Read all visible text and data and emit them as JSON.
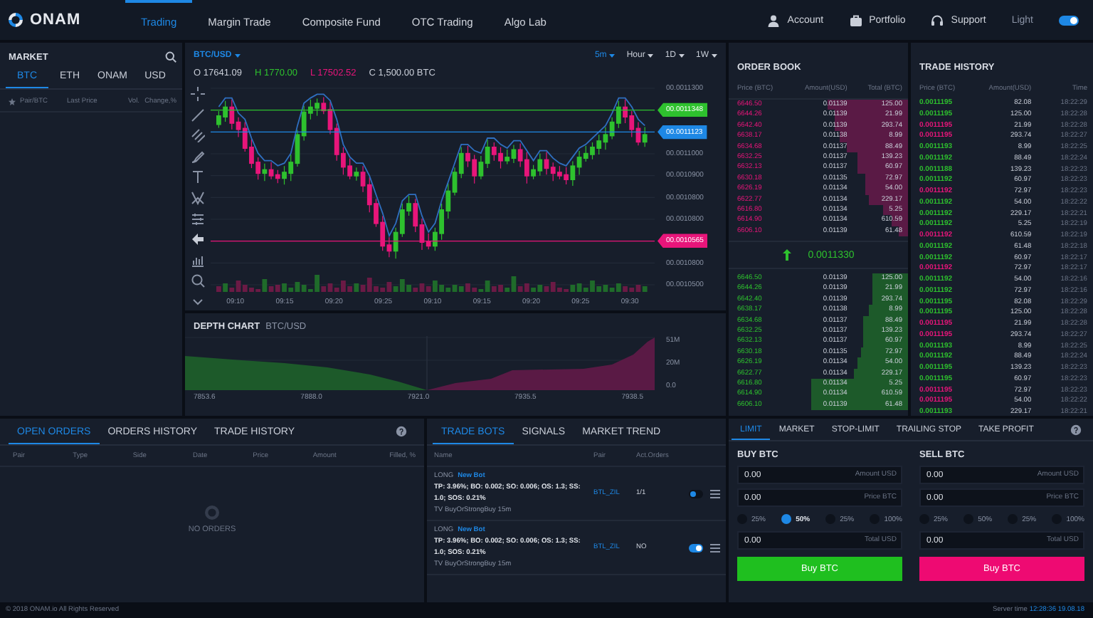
{
  "nav": {
    "logo": "ONAM",
    "items": [
      {
        "label": "Trading",
        "selected": true
      },
      {
        "label": "Margin Trade",
        "selected": false
      },
      {
        "label": "Composite Fund",
        "selected": false
      },
      {
        "label": "OTC Trading",
        "selected": false
      },
      {
        "label": "Algo Lab",
        "selected": false
      }
    ],
    "right": [
      {
        "kind": "account",
        "label": "Account"
      },
      {
        "kind": "portfolio",
        "label": "Portfolio"
      },
      {
        "kind": "support",
        "label": "Support"
      }
    ],
    "theme": {
      "label": "Light",
      "on": true
    }
  },
  "market": {
    "title": "MARKET",
    "tabs": [
      {
        "label": "BTC",
        "selected": true
      },
      {
        "label": "ETH",
        "selected": false
      },
      {
        "label": "ONAM",
        "selected": false
      },
      {
        "label": "USD",
        "selected": false
      }
    ],
    "columns": [
      "Pair/BTC",
      "Last Price",
      "Vol.",
      "Change,%"
    ]
  },
  "chart": {
    "pair": "BTC/USD",
    "intervals": [
      {
        "label": "5m",
        "selected": true
      },
      {
        "label": "Hour",
        "selected": false
      },
      {
        "label": "1D",
        "selected": false
      },
      {
        "label": "1W",
        "selected": false
      }
    ],
    "ohlc": [
      {
        "kind": "open",
        "text": "O 17641.09"
      },
      {
        "kind": "high",
        "text": "H 1770.00"
      },
      {
        "kind": "low",
        "text": "L 17502.52"
      },
      {
        "kind": "close",
        "text": "C 1,500.00 BTC"
      }
    ],
    "y_axis": [
      {
        "kind": "tick",
        "label": "00.0011300"
      },
      {
        "kind": "tag",
        "label": "00.0011348",
        "color": "#2ec12e"
      },
      {
        "kind": "tag",
        "label": "00.0011123",
        "color": "#1e88e5"
      },
      {
        "kind": "tick",
        "label": "00.0011000"
      },
      {
        "kind": "tick",
        "label": "00.0010900"
      },
      {
        "kind": "tick",
        "label": "00.0010800"
      },
      {
        "kind": "tick",
        "label": "00.0010800"
      },
      {
        "kind": "tag",
        "label": "00.0010565",
        "color": "#e8157a"
      },
      {
        "kind": "tick",
        "label": "00.0010800"
      },
      {
        "kind": "tick",
        "label": "00.0010500"
      }
    ],
    "x_axis": [
      "09:10",
      "09:15",
      "09:20",
      "09:25",
      "09:10",
      "09:15",
      "09:20",
      "09:25",
      "09:30"
    ]
  },
  "depth_chart": {
    "title": "DEPTH CHART",
    "pair": "BTC/USD",
    "y_axis": [
      "51M",
      "20M",
      "0.0"
    ],
    "x_axis": [
      "7853.6",
      "7888.0",
      "7921.0",
      "7935.5",
      "7938.5"
    ]
  },
  "order_book": {
    "title": "ORDER BOOK",
    "columns": [
      "Price (BTC)",
      "Amount(USD)",
      "Total (BTC)"
    ],
    "asks": [
      {
        "price": "6646.50",
        "amount": "0.01139",
        "total": "125.00"
      },
      {
        "price": "6644.26",
        "amount": "0.01139",
        "total": "21.99"
      },
      {
        "price": "6642.40",
        "amount": "0.01139",
        "total": "293.74"
      },
      {
        "price": "6638.17",
        "amount": "0.01138",
        "total": "8.99"
      },
      {
        "price": "6634.68",
        "amount": "0.01137",
        "total": "88.49"
      },
      {
        "price": "6632.25",
        "amount": "0.01137",
        "total": "139.23"
      },
      {
        "price": "6632.13",
        "amount": "0.01137",
        "total": "60.97"
      },
      {
        "price": "6630.18",
        "amount": "0.01135",
        "total": "72.97"
      },
      {
        "price": "6626.19",
        "amount": "0.01134",
        "total": "54.00"
      },
      {
        "price": "6622.77",
        "amount": "0.01134",
        "total": "229.17"
      },
      {
        "price": "6616.80",
        "amount": "0.01134",
        "total": "5.25"
      },
      {
        "price": "6614.90",
        "amount": "0.01134",
        "total": "610.59"
      },
      {
        "price": "6606.10",
        "amount": "0.01139",
        "total": "61.48"
      }
    ],
    "last_price": "0.0011330",
    "bids": [
      {
        "price": "6646.50",
        "amount": "0.01139",
        "total": "125.00"
      },
      {
        "price": "6644.26",
        "amount": "0.01139",
        "total": "21.99"
      },
      {
        "price": "6642.40",
        "amount": "0.01139",
        "total": "293.74"
      },
      {
        "price": "6638.17",
        "amount": "0.01138",
        "total": "8.99"
      },
      {
        "price": "6634.68",
        "amount": "0.01137",
        "total": "88.49"
      },
      {
        "price": "6632.25",
        "amount": "0.01137",
        "total": "139.23"
      },
      {
        "price": "6632.13",
        "amount": "0.01137",
        "total": "60.97"
      },
      {
        "price": "6630.18",
        "amount": "0.01135",
        "total": "72.97"
      },
      {
        "price": "6626.19",
        "amount": "0.01134",
        "total": "54.00"
      },
      {
        "price": "6622.77",
        "amount": "0.01134",
        "total": "229.17"
      },
      {
        "price": "6616.80",
        "amount": "0.01134",
        "total": "5.25"
      },
      {
        "price": "6614.90",
        "amount": "0.01134",
        "total": "610.59"
      },
      {
        "price": "6606.10",
        "amount": "0.01139",
        "total": "61.48"
      }
    ]
  },
  "trade_history": {
    "title": "TRADE HISTORY",
    "columns": [
      "Price (BTC)",
      "Amount(USD)",
      "Time"
    ],
    "rows": [
      {
        "price": "0.0011195",
        "amount": "82.08",
        "time": "18:22:29",
        "color": "#2ec12e"
      },
      {
        "price": "0.0011195",
        "amount": "125.00",
        "time": "18:22:28",
        "color": "#2ec12e"
      },
      {
        "price": "0.0011195",
        "amount": "21.99",
        "time": "18:22:28",
        "color": "#e8157a"
      },
      {
        "price": "0.0011195",
        "amount": "293.74",
        "time": "18:22:27",
        "color": "#e8157a"
      },
      {
        "price": "0.0011193",
        "amount": "8.99",
        "time": "18:22:25",
        "color": "#2ec12e"
      },
      {
        "price": "0.0011192",
        "amount": "88.49",
        "time": "18:22:24",
        "color": "#2ec12e"
      },
      {
        "price": "0.0011188",
        "amount": "139.23",
        "time": "18:22:23",
        "color": "#2ec12e"
      },
      {
        "price": "0.0011192",
        "amount": "60.97",
        "time": "18:22:23",
        "color": "#2ec12e"
      },
      {
        "price": "0.0011192",
        "amount": "72.97",
        "time": "18:22:23",
        "color": "#e8157a"
      },
      {
        "price": "0.0011192",
        "amount": "54.00",
        "time": "18:22:22",
        "color": "#2ec12e"
      },
      {
        "price": "0.0011192",
        "amount": "229.17",
        "time": "18:22:21",
        "color": "#2ec12e"
      },
      {
        "price": "0.0011192",
        "amount": "5.25",
        "time": "18:22:19",
        "color": "#2ec12e"
      },
      {
        "price": "0.0011192",
        "amount": "610.59",
        "time": "18:22:19",
        "color": "#e8157a"
      },
      {
        "price": "0.0011192",
        "amount": "61.48",
        "time": "18:22:18",
        "color": "#2ec12e"
      },
      {
        "price": "0.0011192",
        "amount": "60.97",
        "time": "18:22:17",
        "color": "#2ec12e"
      },
      {
        "price": "0.0011192",
        "amount": "72.97",
        "time": "18:22:17",
        "color": "#e8157a"
      },
      {
        "price": "0.0011192",
        "amount": "54.00",
        "time": "18:22:16",
        "color": "#2ec12e"
      },
      {
        "price": "0.0011192",
        "amount": "72.97",
        "time": "18:22:16",
        "color": "#2ec12e"
      },
      {
        "price": "0.0011195",
        "amount": "82.08",
        "time": "18:22:29",
        "color": "#2ec12e"
      },
      {
        "price": "0.0011195",
        "amount": "125.00",
        "time": "18:22:28",
        "color": "#2ec12e"
      },
      {
        "price": "0.0011195",
        "amount": "21.99",
        "time": "18:22:28",
        "color": "#e8157a"
      },
      {
        "price": "0.0011195",
        "amount": "293.74",
        "time": "18:22:27",
        "color": "#e8157a"
      },
      {
        "price": "0.0011193",
        "amount": "8.99",
        "time": "18:22:25",
        "color": "#2ec12e"
      },
      {
        "price": "0.0011192",
        "amount": "88.49",
        "time": "18:22:24",
        "color": "#2ec12e"
      },
      {
        "price": "0.0011195",
        "amount": "139.23",
        "time": "18:22:23",
        "color": "#2ec12e"
      },
      {
        "price": "0.0011195",
        "amount": "60.97",
        "time": "18:22:23",
        "color": "#2ec12e"
      },
      {
        "price": "0.0011195",
        "amount": "72.97",
        "time": "18:22:23",
        "color": "#e8157a"
      },
      {
        "price": "0.0011195",
        "amount": "54.00",
        "time": "18:22:22",
        "color": "#e8157a"
      },
      {
        "price": "0.0011193",
        "amount": "229.17",
        "time": "18:22:21",
        "color": "#2ec12e"
      }
    ]
  },
  "orders": {
    "tabs": [
      {
        "label": "OPEN ORDERS",
        "selected": true
      },
      {
        "label": "ORDERS HISTORY",
        "selected": false
      },
      {
        "label": "TRADE HISTORY",
        "selected": false
      }
    ],
    "columns": [
      "Pair",
      "Type",
      "Side",
      "Date",
      "Price",
      "Amount",
      "Filled, %"
    ],
    "empty": "NO ORDERS"
  },
  "bots": {
    "tabs": [
      {
        "label": "TRADE BOTS",
        "selected": true
      },
      {
        "label": "SIGNALS",
        "selected": false
      },
      {
        "label": "MARKET TREND",
        "selected": false
      }
    ],
    "columns": [
      "Name",
      "Pair",
      "Act.Orders"
    ],
    "rows": [
      {
        "side": "LONG",
        "name": "New Bot",
        "params": "TP: 3.96%; BO: 0.002; SO: 0.006; OS: 1.3; SS: 1.0; SOS: 0.21%",
        "strategy": "TV BuyOrStrongBuy 15m",
        "pair": "BTL_ZIL",
        "orders": "1/1",
        "on": false
      },
      {
        "side": "LONG",
        "name": "New Bot",
        "params": "TP: 3.96%; BO: 0.002; SO: 0.006; OS: 1.3; SS: 1.0; SOS: 0.21%",
        "strategy": "TV BuyOrStrongBuy 15m",
        "pair": "BTL_ZIL",
        "orders": "NO",
        "on": true
      }
    ]
  },
  "trade_form": {
    "tabs": [
      {
        "label": "LIMIT",
        "selected": true
      },
      {
        "label": "MARKET",
        "selected": false
      },
      {
        "label": "STOP-LIMIT",
        "selected": false
      },
      {
        "label": "TRAILING STOP",
        "selected": false
      },
      {
        "label": "TAKE PROFIT",
        "selected": false
      }
    ],
    "sides": [
      {
        "kind": "buy",
        "title": "BUY BTC",
        "fields": [
          {
            "value": "0.00",
            "label": "Amount USD"
          },
          {
            "value": "0.00",
            "label": "Price BTC"
          }
        ],
        "percents": [
          {
            "label": "25%",
            "selected": false
          },
          {
            "label": "50%",
            "selected": true
          },
          {
            "label": "25%",
            "selected": false
          },
          {
            "label": "100%",
            "selected": false
          }
        ],
        "total": {
          "value": "0.00",
          "label": "Total USD"
        },
        "button": "Buy BTC"
      },
      {
        "kind": "sell",
        "title": "SELL BTC",
        "fields": [
          {
            "value": "0.00",
            "label": "Amount USD"
          },
          {
            "value": "0.00",
            "label": "Price BTC"
          }
        ],
        "percents": [
          {
            "label": "25%",
            "selected": false
          },
          {
            "label": "50%",
            "selected": false
          },
          {
            "label": "25%",
            "selected": false
          },
          {
            "label": "100%",
            "selected": false
          }
        ],
        "total": {
          "value": "0.00",
          "label": "Total USD"
        },
        "button": "Buy BTC"
      }
    ]
  },
  "footer": {
    "copyright": "© 2018 ONAM.io All Rights Reserved",
    "server_label": "Server time",
    "server_time": "12:28:36 19.08.18"
  }
}
